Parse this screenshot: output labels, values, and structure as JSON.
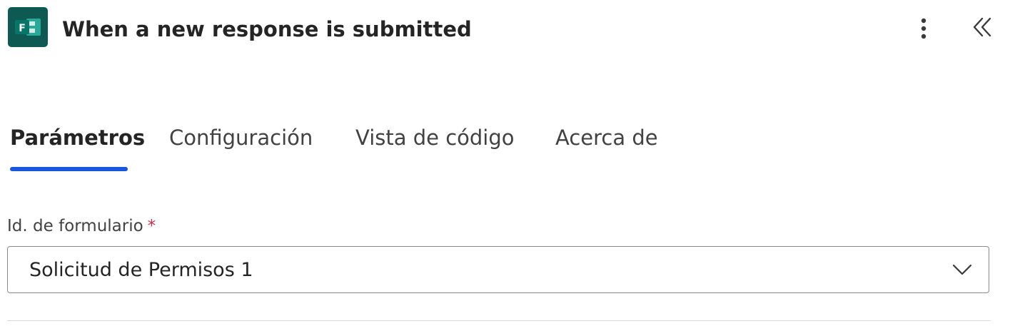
{
  "header": {
    "title": "When a new response is submitted",
    "app_icon": "microsoft-forms-icon",
    "app_icon_letter": "F",
    "more_icon": "more-vertical-icon",
    "collapse_icon": "double-chevron-left-icon"
  },
  "tabs": [
    {
      "label": "Parámetros",
      "active": true
    },
    {
      "label": "Configuración",
      "active": false
    },
    {
      "label": "Vista de código",
      "active": false
    },
    {
      "label": "Acerca de",
      "active": false
    }
  ],
  "form": {
    "field_label": "Id. de formulario",
    "required_marker": "*",
    "selected_value": "Solicitud de Permisos 1"
  },
  "colors": {
    "accent": "#1a56db",
    "app_icon_bg": "#0e5a53",
    "required": "#c4314b"
  }
}
